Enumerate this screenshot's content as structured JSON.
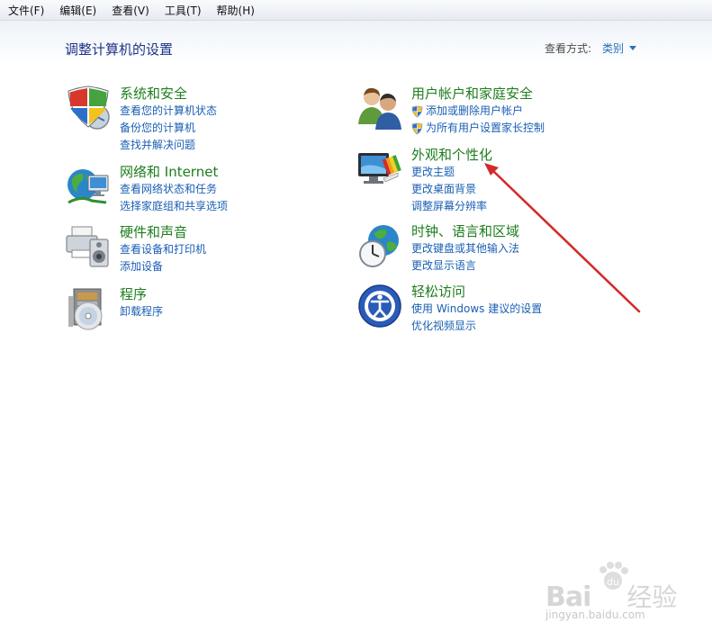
{
  "menubar": {
    "items": [
      "文件(F)",
      "编辑(E)",
      "查看(V)",
      "工具(T)",
      "帮助(H)"
    ]
  },
  "header": {
    "title": "调整计算机的设置",
    "view_label": "查看方式:",
    "view_value": "类别"
  },
  "categories": {
    "system": {
      "title": "系统和安全",
      "icon": "shield-icon",
      "links": [
        "查看您的计算机状态",
        "备份您的计算机",
        "查找并解决问题"
      ]
    },
    "network": {
      "title": "网络和 Internet",
      "icon": "network-globe-icon",
      "links": [
        "查看网络状态和任务",
        "选择家庭组和共享选项"
      ]
    },
    "hardware": {
      "title": "硬件和声音",
      "icon": "printer-speaker-icon",
      "links": [
        "查看设备和打印机",
        "添加设备"
      ]
    },
    "programs": {
      "title": "程序",
      "icon": "programs-disc-icon",
      "links": [
        "卸载程序"
      ]
    },
    "users": {
      "title": "用户帐户和家庭安全",
      "icon": "users-icon",
      "links": [
        "添加或删除用户帐户",
        "为所有用户设置家长控制"
      ]
    },
    "appearance": {
      "title": "外观和个性化",
      "icon": "monitor-palette-icon",
      "links": [
        "更改主题",
        "更改桌面背景",
        "调整屏幕分辨率"
      ]
    },
    "clock": {
      "title": "时钟、语言和区域",
      "icon": "clock-globe-icon",
      "links": [
        "更改键盘或其他输入法",
        "更改显示语言"
      ]
    },
    "ease": {
      "title": "轻松访问",
      "icon": "ease-of-access-icon",
      "links": [
        "使用 Windows 建议的设置",
        "优化视频显示"
      ]
    }
  },
  "annotation": {
    "color": "#d42a2a"
  },
  "watermark": {
    "main": "Bai",
    "paw": "du",
    "suffix": "经验",
    "url": "jingyan.baidu.com"
  },
  "colors": {
    "category_title": "#1e7d1e",
    "link": "#1a5fb4",
    "page_title": "#1e3287"
  }
}
